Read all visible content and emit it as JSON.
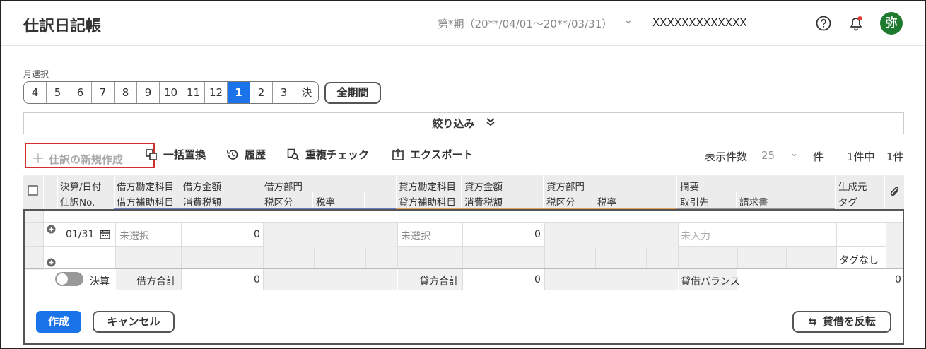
{
  "header": {
    "title": "仕訳日記帳",
    "period": "第*期（20**/04/01〜20**/03/31）",
    "company": "XXXXXXXXXXXXX",
    "avatar": "弥"
  },
  "month_selector": {
    "label": "月選択",
    "months": [
      "4",
      "5",
      "6",
      "7",
      "8",
      "9",
      "10",
      "11",
      "12",
      "1",
      "2",
      "3",
      "決"
    ],
    "selected": "1",
    "all_period": "全期間"
  },
  "filter": {
    "label": "絞り込み"
  },
  "toolbar": {
    "new_entry": "仕訳の新規作成",
    "bulk_replace": "一括置換",
    "history": "履歴",
    "duplicate_check": "重複チェック",
    "export": "エクスポート",
    "count_label": "表示件数",
    "count_value": "25",
    "count_unit": "件",
    "count_of": "1件中",
    "count_total": "1件"
  },
  "columns": {
    "date": "決算/日付",
    "entry_no": "仕訳No.",
    "debit_account": "借方勘定科目",
    "debit_sub": "借方補助科目",
    "debit_amount": "借方金額",
    "debit_tax": "消費税額",
    "debit_dept": "借方部門",
    "debit_tax_class": "税区分",
    "debit_tax_rate": "税率",
    "credit_account": "貸方勘定科目",
    "credit_sub": "貸方補助科目",
    "credit_amount": "貸方金額",
    "credit_tax": "消費税額",
    "credit_dept": "貸方部門",
    "credit_tax_class": "税区分",
    "credit_tax_rate": "税率",
    "memo": "摘要",
    "partner": "取引先",
    "invoice": "請求書",
    "source": "生成元",
    "tag": "タグ"
  },
  "row": {
    "date": "01/31",
    "debit_account": "未選択",
    "debit_amount": "0",
    "credit_account": "未選択",
    "credit_amount": "0",
    "memo_placeholder": "未入力",
    "tag": "タグなし"
  },
  "totals": {
    "closing_label": "決算",
    "debit_total_label": "借方合計",
    "debit_total": "0",
    "credit_total_label": "貸方合計",
    "credit_total": "0",
    "balance_label": "貸借バランス",
    "balance": "0"
  },
  "actions": {
    "create": "作成",
    "cancel": "キャンセル",
    "reverse": "貸借を反転"
  },
  "colors": {
    "accent": "#1a73e8",
    "debit_line": "#6b7fc9",
    "credit_line": "#e8a060",
    "avatar_bg": "#1e7a2e",
    "highlight_border": "#d32f2f"
  }
}
